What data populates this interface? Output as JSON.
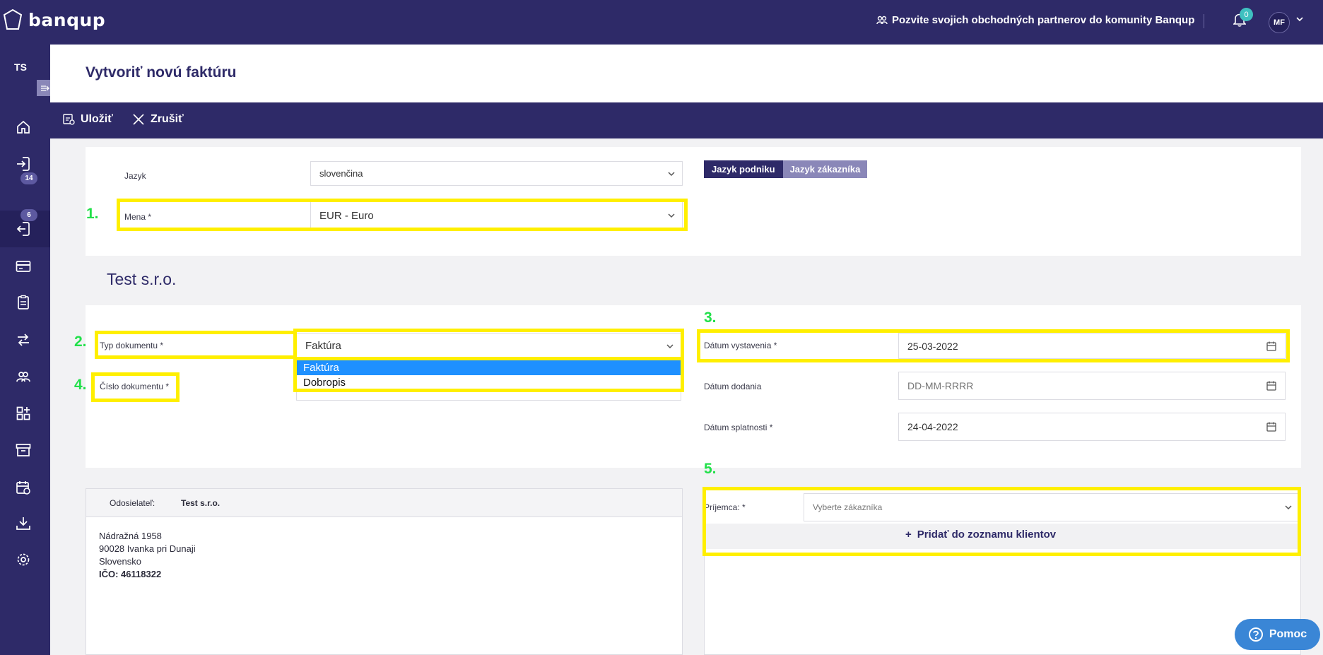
{
  "app": {
    "name": "banqup",
    "invite_text": "Pozvite svojich obchodných partnerov do komunity Banqup",
    "notification_count": "0",
    "user_initials": "MF"
  },
  "sidebar": {
    "company_initials": "TS",
    "items": [
      {
        "name": "home-icon",
        "badge": ""
      },
      {
        "name": "inbox-icon",
        "badge": "14"
      },
      {
        "name": "outbox-icon",
        "badge": "6"
      },
      {
        "name": "card-icon",
        "badge": ""
      },
      {
        "name": "clipboard-icon",
        "badge": ""
      },
      {
        "name": "transfer-icon",
        "badge": ""
      },
      {
        "name": "contacts-icon",
        "badge": ""
      },
      {
        "name": "apps-icon",
        "badge": ""
      },
      {
        "name": "archive-icon",
        "badge": ""
      },
      {
        "name": "calendar-icon",
        "badge": ""
      },
      {
        "name": "download-icon",
        "badge": ""
      },
      {
        "name": "settings-icon",
        "badge": ""
      }
    ]
  },
  "page": {
    "title": "Vytvoriť novú faktúru"
  },
  "actions": {
    "save": "Uložiť",
    "cancel": "Zrušiť"
  },
  "language_card": {
    "language_label": "Jazyk",
    "language_value": "slovenčina",
    "currency_label": "Mena *",
    "currency_value": "EUR - Euro",
    "toggle_company": "Jazyk podniku",
    "toggle_customer": "Jazyk zákazníka"
  },
  "company_name": "Test s.r.o.",
  "document_card": {
    "type_label": "Typ dokumentu *",
    "type_value": "Faktúra",
    "type_options": [
      "Faktúra",
      "Dobropis"
    ],
    "number_label": "Číslo dokumentu *",
    "issue_label": "Dátum vystavenia *",
    "issue_value": "25-03-2022",
    "delivery_label": "Dátum dodania",
    "delivery_placeholder": "DD-MM-RRRR",
    "due_label": "Dátum splatnosti *",
    "due_value": "24-04-2022"
  },
  "sender": {
    "label": "Odosielateľ:",
    "name": "Test s.r.o.",
    "street": "Nádražná 1958",
    "city": "90028 Ivanka pri Dunaji",
    "country": "Slovensko",
    "ico": "IČO: 46118322"
  },
  "recipient": {
    "label": "Príjemca: *",
    "placeholder": "Vyberte zákazníka",
    "add_label": "Pridať do zoznamu klientov"
  },
  "annotations": [
    "1.",
    "2.",
    "3.",
    "4.",
    "5."
  ],
  "help_label": "Pomoc",
  "colors": {
    "brand": "#2e2a68",
    "highlight": "#ffef00",
    "annotation": "#22e04a",
    "selected_option": "#1e90ff",
    "help": "#3a86d6"
  }
}
